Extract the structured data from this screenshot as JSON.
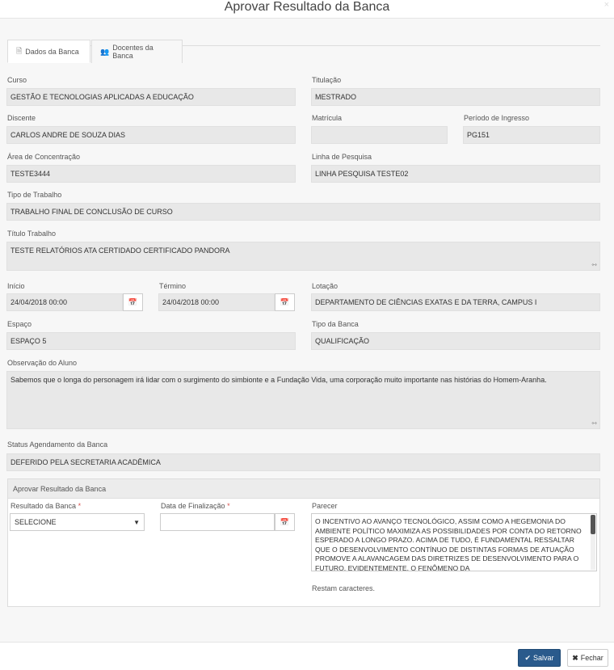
{
  "modal": {
    "title": "Aprovar Resultado da Banca",
    "close_glyph": "×"
  },
  "tabs": [
    {
      "label": "Dados da Banca",
      "icon": "document-icon"
    },
    {
      "label": "Docentes da Banca",
      "icon": "users-icon"
    }
  ],
  "fields": {
    "curso": {
      "label": "Curso",
      "value": "GESTÃO E TECNOLOGIAS APLICADAS A EDUCAÇÃO"
    },
    "titulacao": {
      "label": "Titulação",
      "value": "MESTRADO"
    },
    "discente": {
      "label": "Discente",
      "value": "CARLOS ANDRE DE SOUZA DIAS"
    },
    "matricula": {
      "label": "Matrícula",
      "value": ""
    },
    "periodo": {
      "label": "Período de Ingresso",
      "value": "PG151"
    },
    "area": {
      "label": "Área de Concentração",
      "value": "TESTE3444"
    },
    "linha": {
      "label": "Linha de Pesquisa",
      "value": "LINHA PESQUISA TESTE02"
    },
    "tipo_trabalho": {
      "label": "Tipo de Trabalho",
      "value": "TRABALHO FINAL DE CONCLUSÃO DE CURSO"
    },
    "titulo": {
      "label": "Título Trabalho",
      "value": "TESTE RELATÓRIOS ATA CERTIDADO CERTIFICADO PANDORA"
    },
    "inicio": {
      "label": "Início",
      "value": "24/04/2018 00:00"
    },
    "termino": {
      "label": "Término",
      "value": "24/04/2018 00:00"
    },
    "lotacao": {
      "label": "Lotação",
      "value": "DEPARTAMENTO DE CIÊNCIAS EXATAS E DA TERRA, CAMPUS I"
    },
    "espaco": {
      "label": "Espaço",
      "value": "ESPAÇO 5"
    },
    "tipo_banca": {
      "label": "Tipo da Banca",
      "value": "QUALIFICAÇÃO"
    },
    "observacao": {
      "label": "Observação do Aluno",
      "value": "Sabemos que o longa do personagem irá lidar com o surgimento do simbionte e a Fundação Vida, uma corporação muito importante nas histórias do Homem-Aranha."
    },
    "status": {
      "label": "Status Agendamento da Banca",
      "value": "DEFERIDO PELA SECRETARIA ACADÊMICA"
    }
  },
  "approval": {
    "heading": "Aprovar Resultado da Banca",
    "resultado_label": "Resultado da Banca",
    "resultado_value": "SELECIONE",
    "data_label": "Data de Finalização",
    "required_mark": "*",
    "parecer_label": "Parecer",
    "parecer_text": "O INCENTIVO AO AVANÇO TECNOLÓGICO, ASSIM COMO A HEGEMONIA DO AMBIENTE POLÍTICO MAXIMIZA AS POSSIBILIDADES POR CONTA DO RETORNO ESPERADO A LONGO PRAZO. ACIMA DE TUDO, É FUNDAMENTAL RESSALTAR QUE O DESENVOLVIMENTO CONTÍNUO DE DISTINTAS FORMAS DE ATUAÇÃO PROMOVE A ALAVANCAGEM DAS DIRETRIZES DE DESENVOLVIMENTO PARA O FUTURO. EVIDENTEMENTE, O FENÔMENO DA",
    "chars_left": "Restam caracteres."
  },
  "footer": {
    "save_label": "Salvar",
    "close_label": "Fechar"
  },
  "colors": {
    "primary": "#2a5a8c",
    "field_bg": "#e8e8e8",
    "required": "#d9534f"
  }
}
